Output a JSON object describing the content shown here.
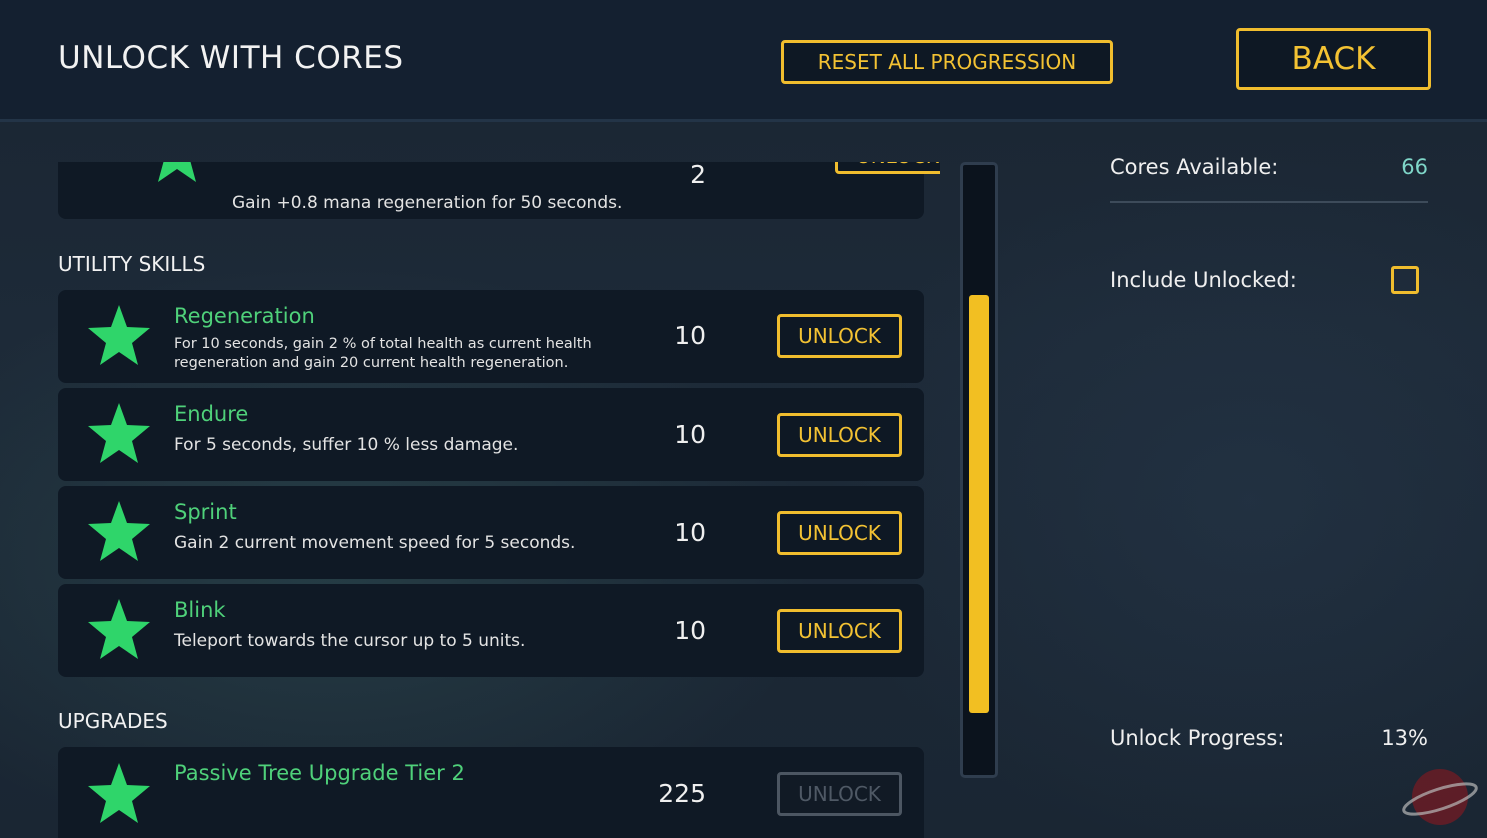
{
  "header": {
    "title": "UNLOCK WITH CORES",
    "reset_label": "RESET ALL PROGRESSION",
    "back_label": "BACK"
  },
  "list": {
    "top_partial_item": {
      "description": "Gain +0.8 mana regeneration for 50 seconds.",
      "cost": "2",
      "button": "UNLOCK"
    },
    "sections": [
      {
        "heading": "UTILITY SKILLS",
        "items": [
          {
            "name": "Regeneration",
            "description": "For 10 seconds, gain 2 % of total health as current health regeneration and gain 20 current health regeneration.",
            "cost": "10",
            "button": "UNLOCK",
            "enabled": true
          },
          {
            "name": "Endure",
            "description": "For 5 seconds, suffer 10 % less damage.",
            "cost": "10",
            "button": "UNLOCK",
            "enabled": true
          },
          {
            "name": "Sprint",
            "description": "Gain 2 current movement speed for 5 seconds.",
            "cost": "10",
            "button": "UNLOCK",
            "enabled": true
          },
          {
            "name": "Blink",
            "description": "Teleport towards the cursor up to 5 units.",
            "cost": "10",
            "button": "UNLOCK",
            "enabled": true
          }
        ]
      },
      {
        "heading": "UPGRADES",
        "items": [
          {
            "name": "Passive Tree Upgrade Tier 2",
            "description": "",
            "cost": "225",
            "button": "UNLOCK",
            "enabled": false
          }
        ]
      }
    ],
    "star_icon": "star-icon",
    "scrollbar_position": 0.68
  },
  "sidebar": {
    "cores_label": "Cores Available:",
    "cores_value": "66",
    "include_unlocked_label": "Include Unlocked:",
    "include_unlocked_checked": false,
    "progress_label": "Unlock Progress:",
    "progress_value": "13%"
  },
  "colors": {
    "accent_gold": "#f0bd2e",
    "skill_green": "#4fd17a",
    "cores_teal": "#7fd6c8",
    "panel_bg": "#0f1925"
  }
}
